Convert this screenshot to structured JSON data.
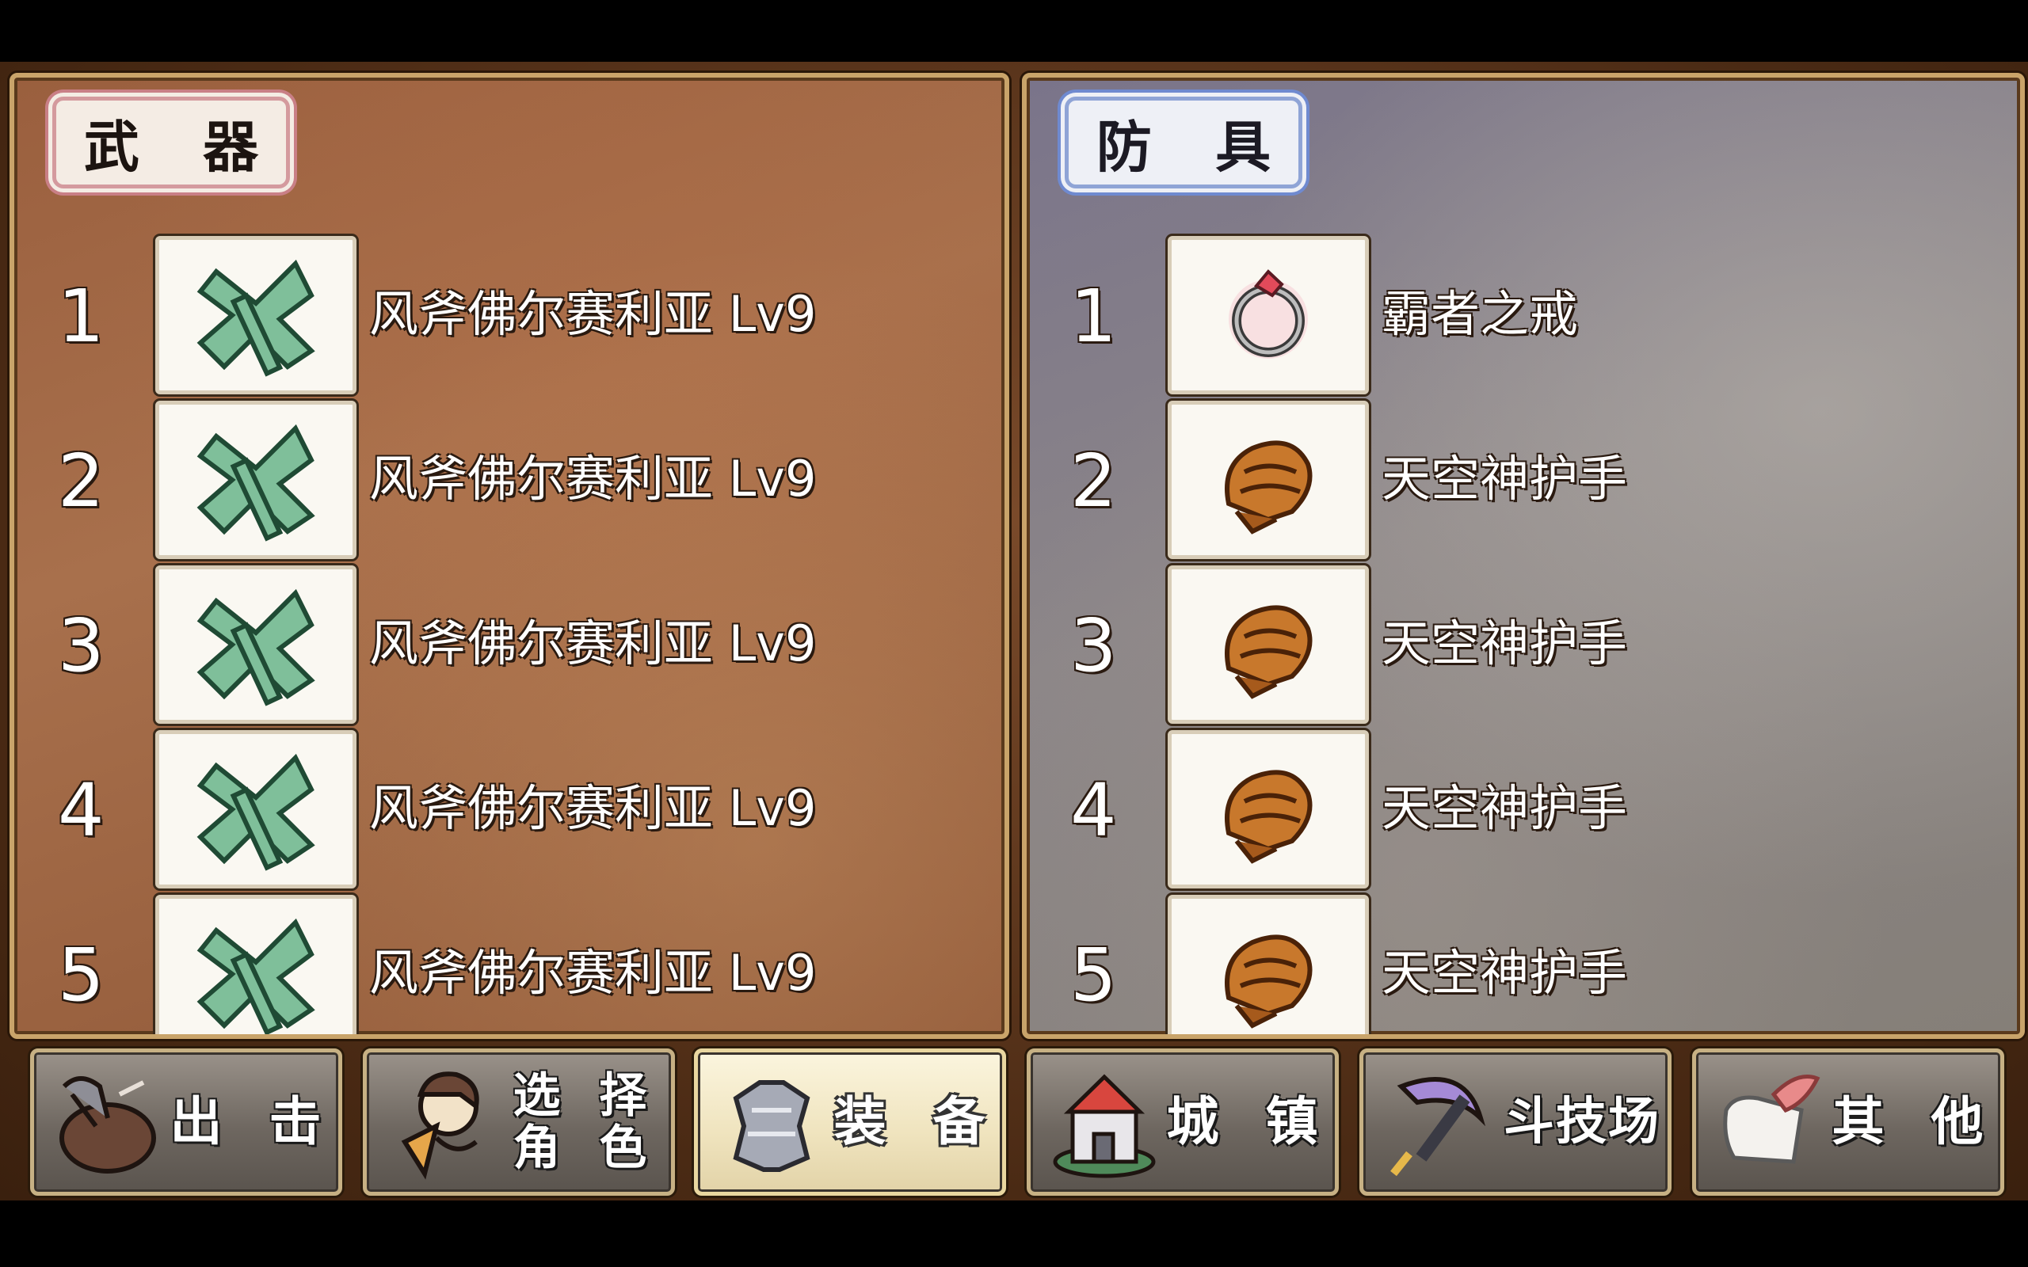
{
  "weapons": {
    "title": "武 器",
    "slots": [
      {
        "num": "1",
        "name": "风斧佛尔赛利亚 Lv9",
        "icon": "axe-icon"
      },
      {
        "num": "2",
        "name": "风斧佛尔赛利亚 Lv9",
        "icon": "axe-icon"
      },
      {
        "num": "3",
        "name": "风斧佛尔赛利亚 Lv9",
        "icon": "axe-icon"
      },
      {
        "num": "4",
        "name": "风斧佛尔赛利亚 Lv9",
        "icon": "axe-icon"
      },
      {
        "num": "5",
        "name": "风斧佛尔赛利亚 Lv9",
        "icon": "axe-icon"
      }
    ]
  },
  "armor": {
    "title": "防 具",
    "slots": [
      {
        "num": "1",
        "name": "霸者之戒",
        "icon": "ring-icon"
      },
      {
        "num": "2",
        "name": "天空神护手",
        "icon": "gauntlet-icon"
      },
      {
        "num": "3",
        "name": "天空神护手",
        "icon": "gauntlet-icon"
      },
      {
        "num": "4",
        "name": "天空神护手",
        "icon": "gauntlet-icon"
      },
      {
        "num": "5",
        "name": "天空神护手",
        "icon": "gauntlet-icon"
      }
    ]
  },
  "nav": {
    "sortie": "出 击",
    "select_line1": "选 择",
    "select_line2": "角 色",
    "equip": "装 备",
    "town": "城 镇",
    "arena": "斗技场",
    "other": "其 他",
    "active": "equip"
  }
}
